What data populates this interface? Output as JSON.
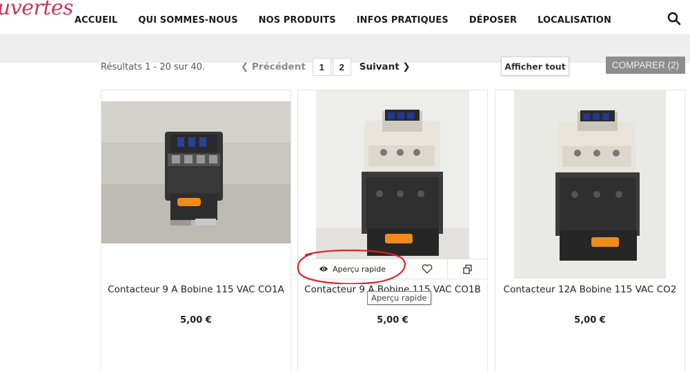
{
  "header": {
    "logo_text": "uvertes",
    "nav": [
      "ACCUEIL",
      "QUI SOMMES-NOUS",
      "NOS PRODUITS",
      "INFOS PRATIQUES",
      "DÉPOSER",
      "LOCALISATION"
    ],
    "search_icon": "search-icon"
  },
  "results": {
    "summary": "Résultats 1 - 20 sur 40.",
    "prev_label": "Précédent",
    "pages": [
      "1",
      "2"
    ],
    "next_label": "Suivant",
    "show_all_label": "Afficher tout",
    "compare_label": "COMPARER (2)"
  },
  "products": [
    {
      "name": "Contacteur 9 A Bobine 115 VAC CO1A",
      "price": "5,00 €",
      "label_tag": "CO1A"
    },
    {
      "name": "Contacteur 9 A Bobine 115 VAC CO1B",
      "price": "5,00 €",
      "label_tag": "CO1B"
    },
    {
      "name": "Contacteur 12A Bobine 115 VAC CO2",
      "price": "5,00 €",
      "label_tag": "CO2"
    }
  ],
  "quick_actions": {
    "quick_view_label": "Aperçu rapide",
    "tooltip": "Aperçu rapide"
  },
  "colors": {
    "logo": "#c0395a",
    "compare_button": "#8d8d8d",
    "annotation_circle": "#e02020",
    "product_label": "#f08a1c"
  }
}
